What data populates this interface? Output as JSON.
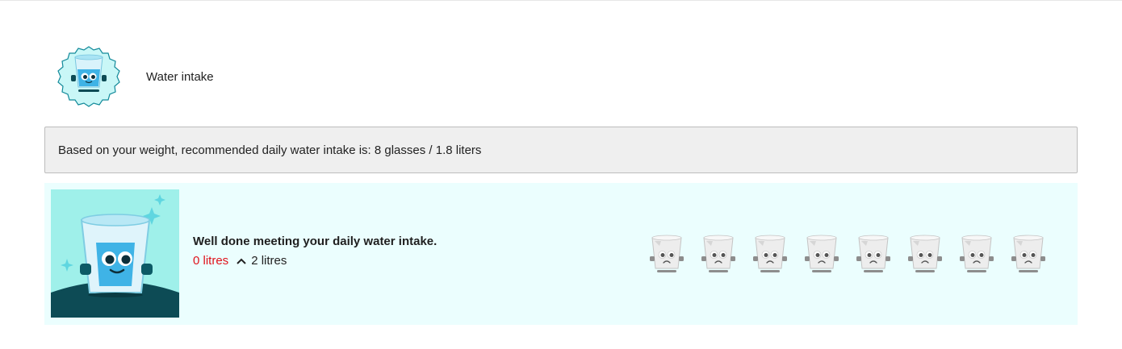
{
  "header": {
    "title": "Water intake",
    "badge_icon": "water-glass-badge-icon"
  },
  "info": {
    "text": "Based on your weight, recommended daily water intake is: 8 glasses / 1.8 liters"
  },
  "panel": {
    "background": "#ebfefe",
    "hero_icon": "happy-water-glass-icon",
    "message": "Well done meeting your daily water intake.",
    "current": "0 litres",
    "current_color": "#e0121b",
    "target_icon": "chevron-up-icon",
    "target": "2 litres",
    "glasses": [
      {
        "state": "empty",
        "icon": "sad-empty-glass-icon"
      },
      {
        "state": "empty",
        "icon": "sad-empty-glass-icon"
      },
      {
        "state": "empty",
        "icon": "sad-empty-glass-icon"
      },
      {
        "state": "empty",
        "icon": "sad-empty-glass-icon"
      },
      {
        "state": "empty",
        "icon": "sad-empty-glass-icon"
      },
      {
        "state": "empty",
        "icon": "sad-empty-glass-icon"
      },
      {
        "state": "empty",
        "icon": "sad-empty-glass-icon"
      },
      {
        "state": "empty",
        "icon": "sad-empty-glass-icon"
      }
    ]
  }
}
